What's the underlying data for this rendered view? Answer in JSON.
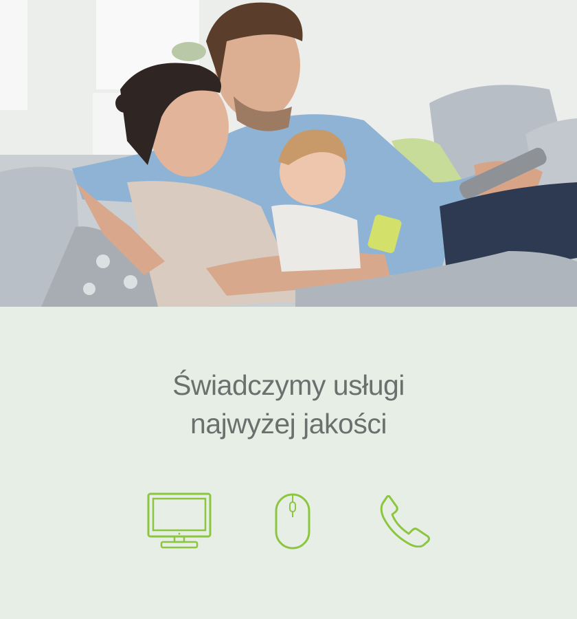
{
  "headline": {
    "line1": "Świadczymy usługi",
    "line2": "najwyżej jakości"
  },
  "hero_image": {
    "subject": "family-watching-tv-photo"
  },
  "services": [
    {
      "icon": "tv-icon"
    },
    {
      "icon": "mouse-icon"
    },
    {
      "icon": "phone-icon"
    }
  ],
  "colors": {
    "panel_background": "#e6eee6",
    "headline_text": "#6b6f6d",
    "icon_accent": "#8cc63f"
  }
}
